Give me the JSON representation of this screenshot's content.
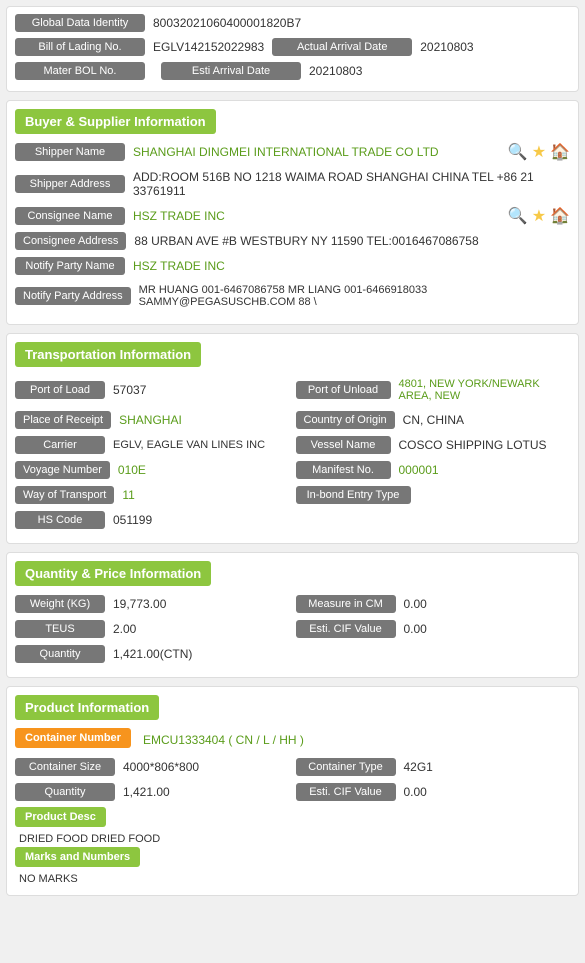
{
  "global": {
    "label": "Global Data Identity",
    "value": "80032021060400001820B7"
  },
  "bol": {
    "label": "Bill of Lading No.",
    "value": "EGLV142152022983",
    "arrival_label": "Actual Arrival Date",
    "arrival_value": "20210803"
  },
  "mater": {
    "label": "Mater BOL No.",
    "value": "",
    "esti_label": "Esti Arrival Date",
    "esti_value": "20210803"
  },
  "buyer_supplier": {
    "header": "Buyer & Supplier Information",
    "shipper_name_label": "Shipper Name",
    "shipper_name_value": "SHANGHAI DINGMEI INTERNATIONAL TRADE CO LTD",
    "shipper_address_label": "Shipper Address",
    "shipper_address_value": "ADD:ROOM 516B NO 1218 WAIMA ROAD SHANGHAI CHINA TEL +86 21 33761911",
    "consignee_name_label": "Consignee Name",
    "consignee_name_value": "HSZ TRADE INC",
    "consignee_address_label": "Consignee Address",
    "consignee_address_value": "88 URBAN AVE #B WESTBURY NY 11590 TEL:0016467086758",
    "notify_party_name_label": "Notify Party Name",
    "notify_party_name_value": "HSZ TRADE INC",
    "notify_party_address_label": "Notify Party Address",
    "notify_party_address_value": "MR HUANG 001-6467086758 MR LIANG 001-6466918033 SAMMY@PEGASUSCHB.COM 88 \\"
  },
  "transportation": {
    "header": "Transportation Information",
    "port_load_label": "Port of Load",
    "port_load_value": "57037",
    "port_unload_label": "Port of Unload",
    "port_unload_value": "4801, NEW YORK/NEWARK AREA, NEW",
    "place_receipt_label": "Place of Receipt",
    "place_receipt_value": "SHANGHAI",
    "country_origin_label": "Country of Origin",
    "country_origin_value": "CN, CHINA",
    "carrier_label": "Carrier",
    "carrier_value": "EGLV, EAGLE VAN LINES INC",
    "vessel_name_label": "Vessel Name",
    "vessel_name_value": "COSCO SHIPPING LOTUS",
    "voyage_number_label": "Voyage Number",
    "voyage_number_value": "010E",
    "manifest_no_label": "Manifest No.",
    "manifest_no_value": "000001",
    "way_transport_label": "Way of Transport",
    "way_transport_value": "11",
    "inbond_label": "In-bond Entry Type",
    "inbond_value": "",
    "hs_code_label": "HS Code",
    "hs_code_value": "051199"
  },
  "quantity_price": {
    "header": "Quantity & Price Information",
    "weight_label": "Weight (KG)",
    "weight_value": "19,773.00",
    "measure_label": "Measure in CM",
    "measure_value": "0.00",
    "teus_label": "TEUS",
    "teus_value": "2.00",
    "esti_cif_label": "Esti. CIF Value",
    "esti_cif_value": "0.00",
    "quantity_label": "Quantity",
    "quantity_value": "1,421.00(CTN)"
  },
  "product": {
    "header": "Product Information",
    "container_number_label": "Container Number",
    "container_number_value": "EMCU1333404 ( CN / L / HH )",
    "container_size_label": "Container Size",
    "container_size_value": "4000*806*800",
    "container_type_label": "Container Type",
    "container_type_value": "42G1",
    "quantity_label": "Quantity",
    "quantity_value": "1,421.00",
    "esti_cif_label": "Esti. CIF Value",
    "esti_cif_value": "0.00",
    "product_desc_btn": "Product Desc",
    "product_desc_value": "DRIED FOOD DRIED FOOD",
    "marks_numbers_btn": "Marks and Numbers",
    "marks_numbers_value": "NO MARKS"
  }
}
